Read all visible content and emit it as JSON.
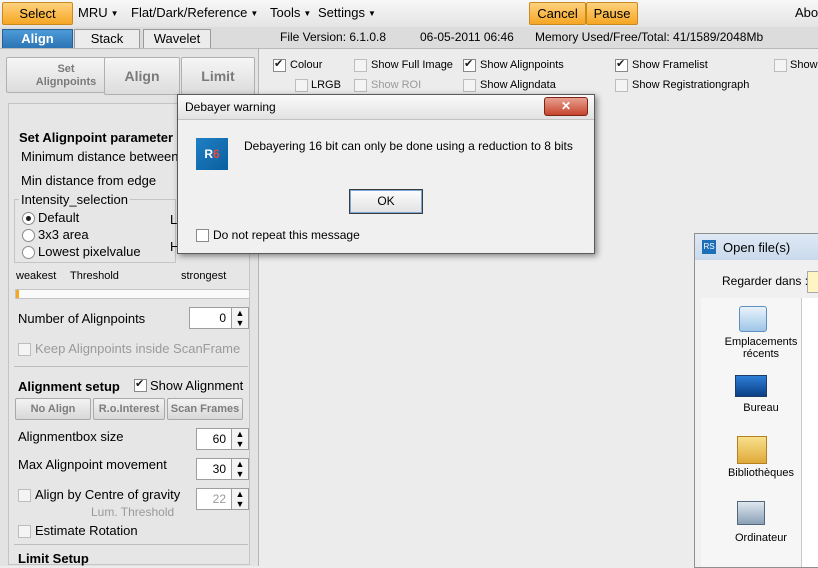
{
  "menu": {
    "select": "Select",
    "mru": "MRU",
    "flat": "Flat/Dark/Reference",
    "tools": "Tools",
    "settings": "Settings",
    "cancel": "Cancel",
    "pause": "Pause",
    "about": "Abo"
  },
  "tabs": {
    "align": "Align",
    "stack": "Stack",
    "wavelet": "Wavelet"
  },
  "info": {
    "version": "File Version: 6.1.0.8",
    "date": "06-05-2011 06:46",
    "memory": "Memory Used/Free/Total: 41/1589/2048Mb"
  },
  "buttons": {
    "set_alignpoints": [
      "Set",
      "Alignpoints"
    ],
    "align": "Align",
    "limit": "Limit"
  },
  "options": {
    "colour": "Colour",
    "lrgb": "LRGB",
    "show_full_image": "Show Full Image",
    "show_roi": "Show ROI",
    "show_alignpoints": "Show Alignpoints",
    "show_aligndata": "Show Aligndata",
    "show_framelist": "Show Framelist",
    "show_registrationgraph": "Show Registrationgraph",
    "show_cut": "Show"
  },
  "left": {
    "set_alignpoint_params": "Set Alignpoint parameter",
    "min_distance_between": "Minimum distance between",
    "min_distance_edge": "Min distance from edge",
    "intensity_selection": "Intensity_selection",
    "radio_default": "Default",
    "radio_3x3": "3x3 area",
    "radio_lowest": "Lowest pixelvalue",
    "side_l": "L",
    "side_h": "H",
    "weakest": "weakest",
    "threshold": "Threshold",
    "strongest": "strongest",
    "num_alignpoints": "Number of Alignpoints",
    "num_alignpoints_value": "0",
    "keep_inside": "Keep Alignpoints inside ScanFrame",
    "alignment_setup": "Alignment setup",
    "show_alignment": "Show Alignment",
    "no_align": "No Align",
    "ro_interest": "R.o.Interest",
    "scan_frames": "Scan Frames",
    "alignmentbox_size": "Alignmentbox size",
    "alignmentbox_value": "60",
    "max_movement": "Max Alignpoint movement",
    "max_movement_value": "30",
    "centre_gravity": "Align by Centre of gravity",
    "centre_gravity_value": "22",
    "lum_threshold": "Lum. Threshold",
    "estimate_rotation": "Estimate Rotation",
    "limit_setup": "Limit Setup"
  },
  "dialog": {
    "title": "Debayer warning",
    "close": "✕",
    "message": "Debayering 16 bit can only be done using a reduction to 8 bits",
    "ok": "OK",
    "dont_repeat": "Do not repeat this message"
  },
  "openfile": {
    "title": "Open file(s)",
    "look_in": "Regarder dans :",
    "places": [
      "Emplacements récents",
      "Bureau",
      "Bibliothèques",
      "Ordinateur"
    ]
  },
  "colors": {
    "accent_orange": "#f5a623",
    "tab_blue": "#2d74b5"
  }
}
